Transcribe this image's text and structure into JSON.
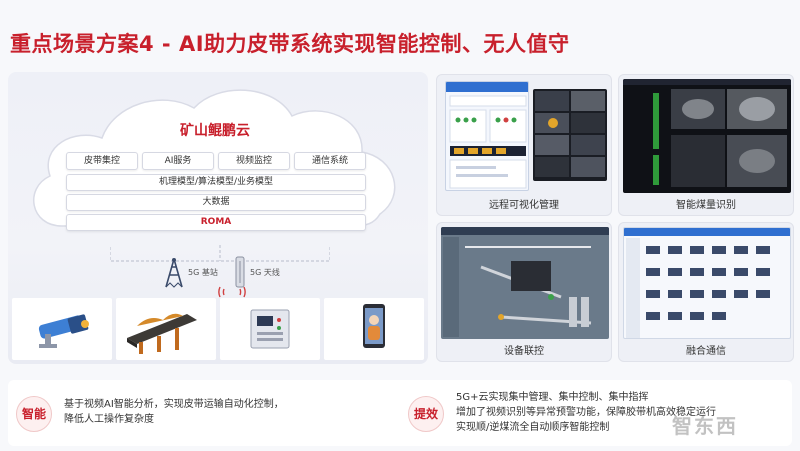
{
  "title": "重点场景方案4 - AI助力皮带系统实现智能控制、无人值守",
  "cloud": {
    "name": "矿山鲲鹏云",
    "services": [
      "皮带集控",
      "AI服务",
      "视频监控",
      "通信系统"
    ],
    "layers": [
      "机理模型/算法模型/业务模型",
      "大数据",
      "ROMA"
    ]
  },
  "network": {
    "base_station": "5G 基站",
    "antenna": "5G 天线"
  },
  "panels": [
    {
      "caption": "远程可视化管理"
    },
    {
      "caption": "智能煤量识别"
    },
    {
      "caption": "设备联控"
    },
    {
      "caption": "融合通信"
    }
  ],
  "bottom": {
    "smart": {
      "badge": "智能",
      "lines": [
        "基于视频AI智能分析，实现皮带运输自动化控制，",
        "降低人工操作复杂度"
      ]
    },
    "efficiency": {
      "badge": "提效",
      "lines": [
        "5G+云实现集中管理、集中控制、集中指挥",
        "增加了视频识别等异常预警功能，保障胶带机高效稳定运行",
        "实现顺/逆煤流全自动顺序智能控制"
      ]
    }
  },
  "watermark": "智东西",
  "colors": {
    "accent": "#c8202c",
    "panel_bg": "#eef0f6"
  }
}
